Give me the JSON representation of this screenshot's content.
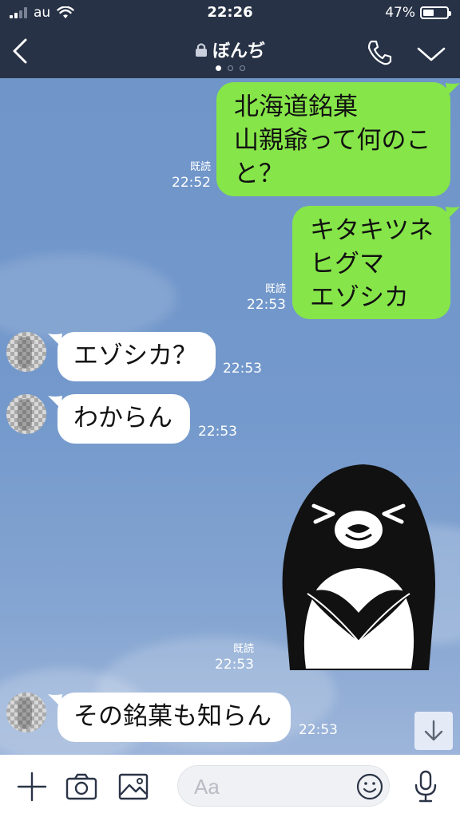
{
  "status_bar": {
    "carrier": "au",
    "time": "22:26",
    "battery_percent": "47%",
    "battery_level": 0.47,
    "signal_bars": 2
  },
  "header": {
    "title": "ぼんぢ",
    "page_dots": 3,
    "active_dot": 0
  },
  "messages": [
    {
      "direction": "outgoing",
      "lines": [
        "北海道銘菓",
        "山親爺って何のこ",
        "と？"
      ],
      "read_label": "既読",
      "time": "22:52"
    },
    {
      "direction": "outgoing",
      "lines": [
        "キタキツネ",
        "ヒグマ",
        "エゾシカ"
      ],
      "read_label": "既読",
      "time": "22:53"
    },
    {
      "direction": "incoming",
      "lines": [
        "エゾシカ？"
      ],
      "time": "22:53"
    },
    {
      "direction": "incoming",
      "lines": [
        "わからん"
      ],
      "time": "22:53"
    },
    {
      "direction": "outgoing",
      "type": "sticker",
      "sticker": "penguin-sticker",
      "read_label": "既読",
      "time": "22:53"
    },
    {
      "direction": "incoming",
      "lines": [
        "その銘菓も知らん"
      ],
      "time": "22:53"
    }
  ],
  "input": {
    "placeholder": "Aa",
    "value": ""
  },
  "colors": {
    "header_bg": "#273246",
    "chat_bg": "#7499cc",
    "outgoing_bubble": "#86e549",
    "incoming_bubble": "#ffffff"
  },
  "icons": [
    "back-icon",
    "lock-icon",
    "phone-icon",
    "chevron-down-icon",
    "scroll-down-icon",
    "plus-icon",
    "camera-icon",
    "image-icon",
    "emoji-icon",
    "microphone-icon"
  ]
}
